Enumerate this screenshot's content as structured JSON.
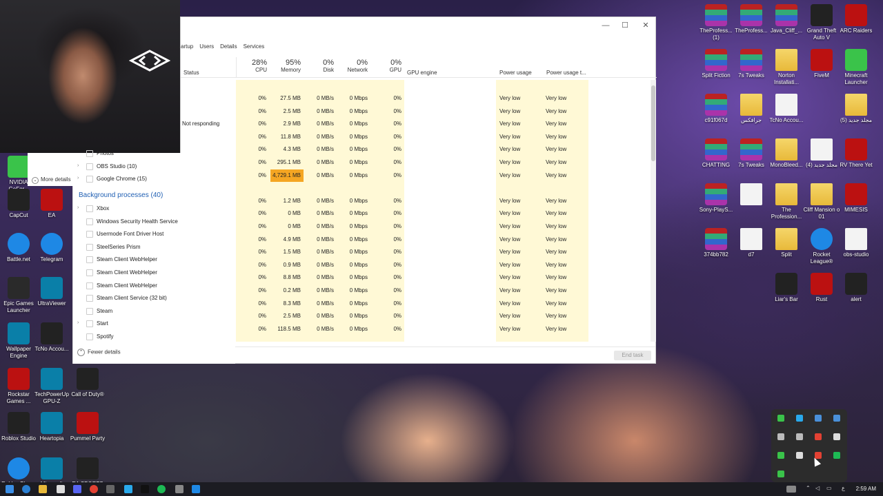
{
  "window": {
    "tabs": [
      "artup",
      "Users",
      "Details",
      "Services"
    ],
    "controls": {
      "minimize": "—",
      "maximize": "☐",
      "close": "✕"
    }
  },
  "columns": {
    "status": "Status",
    "cpu": {
      "pct": "28%",
      "label": "CPU"
    },
    "memory": {
      "pct": "95%",
      "label": "Memory"
    },
    "disk": {
      "pct": "0%",
      "label": "Disk"
    },
    "network": {
      "pct": "0%",
      "label": "Network"
    },
    "gpu": {
      "pct": "0%",
      "label": "GPU"
    },
    "gpu_engine": "GPU engine",
    "power": "Power usage",
    "power_trend": "Power usage t..."
  },
  "rows": [
    {
      "status": "",
      "cpu": "0%",
      "mem": "27.5 MB",
      "disk": "0 MB/s",
      "net": "0 Mbps",
      "gpu": "0%",
      "power": "Very low",
      "trend": "Very low"
    },
    {
      "status": "",
      "cpu": "0%",
      "mem": "2.5 MB",
      "disk": "0 MB/s",
      "net": "0 Mbps",
      "gpu": "0%",
      "power": "Very low",
      "trend": "Very low"
    },
    {
      "status": "Not responding",
      "cpu": "0%",
      "mem": "2.9 MB",
      "disk": "0 MB/s",
      "net": "0 Mbps",
      "gpu": "0%",
      "power": "Very low",
      "trend": "Very low"
    },
    {
      "status": "",
      "cpu": "0%",
      "mem": "11.8 MB",
      "disk": "0 MB/s",
      "net": "0 Mbps",
      "gpu": "0%",
      "power": "Very low",
      "trend": "Very low"
    },
    {
      "status": "",
      "cpu": "0%",
      "mem": "4.3 MB",
      "disk": "0 MB/s",
      "net": "0 Mbps",
      "gpu": "0%",
      "power": "Very low",
      "trend": "Very low"
    },
    {
      "status": "",
      "cpu": "0%",
      "mem": "295.1 MB",
      "disk": "0 MB/s",
      "net": "0 Mbps",
      "gpu": "0%",
      "power": "Very low",
      "trend": "Very low"
    },
    {
      "status": "",
      "cpu": "0%",
      "mem": "4,729.1 MB",
      "disk": "0 MB/s",
      "net": "0 Mbps",
      "gpu": "0%",
      "power": "Very low",
      "trend": "Very low",
      "highlight": true
    },
    {
      "spacer": true
    },
    {
      "status": "",
      "cpu": "0%",
      "mem": "1.2 MB",
      "disk": "0 MB/s",
      "net": "0 Mbps",
      "gpu": "0%",
      "power": "Very low",
      "trend": "Very low"
    },
    {
      "status": "",
      "cpu": "0%",
      "mem": "0 MB",
      "disk": "0 MB/s",
      "net": "0 Mbps",
      "gpu": "0%",
      "power": "Very low",
      "trend": "Very low"
    },
    {
      "status": "",
      "cpu": "0%",
      "mem": "0 MB",
      "disk": "0 MB/s",
      "net": "0 Mbps",
      "gpu": "0%",
      "power": "Very low",
      "trend": "Very low"
    },
    {
      "status": "",
      "cpu": "0%",
      "mem": "4.9 MB",
      "disk": "0 MB/s",
      "net": "0 Mbps",
      "gpu": "0%",
      "power": "Very low",
      "trend": "Very low"
    },
    {
      "status": "",
      "cpu": "0%",
      "mem": "1.5 MB",
      "disk": "0 MB/s",
      "net": "0 Mbps",
      "gpu": "0%",
      "power": "Very low",
      "trend": "Very low"
    },
    {
      "status": "",
      "cpu": "0%",
      "mem": "0.9 MB",
      "disk": "0 MB/s",
      "net": "0 Mbps",
      "gpu": "0%",
      "power": "Very low",
      "trend": "Very low"
    },
    {
      "status": "",
      "cpu": "0%",
      "mem": "8.8 MB",
      "disk": "0 MB/s",
      "net": "0 Mbps",
      "gpu": "0%",
      "power": "Very low",
      "trend": "Very low"
    },
    {
      "status": "",
      "cpu": "0%",
      "mem": "0.2 MB",
      "disk": "0 MB/s",
      "net": "0 Mbps",
      "gpu": "0%",
      "power": "Very low",
      "trend": "Very low"
    },
    {
      "status": "",
      "cpu": "0%",
      "mem": "8.3 MB",
      "disk": "0 MB/s",
      "net": "0 Mbps",
      "gpu": "0%",
      "power": "Very low",
      "trend": "Very low"
    },
    {
      "status": "",
      "cpu": "0%",
      "mem": "2.5 MB",
      "disk": "0 MB/s",
      "net": "0 Mbps",
      "gpu": "0%",
      "power": "Very low",
      "trend": "Very low"
    },
    {
      "status": "",
      "cpu": "0%",
      "mem": "118.5 MB",
      "disk": "0 MB/s",
      "net": "0 Mbps",
      "gpu": "0%",
      "power": "Very low",
      "trend": "Very low"
    }
  ],
  "processes": {
    "apps": [
      {
        "name": "Photos",
        "expand": false
      },
      {
        "name": "OBS Studio (10)",
        "expand": true
      },
      {
        "name": "Google Chrome (15)",
        "expand": true
      }
    ],
    "background_title": "Background processes (40)",
    "background": [
      {
        "name": "Xbox",
        "expand": true
      },
      {
        "name": "Windows Security Health Service",
        "expand": false
      },
      {
        "name": "Usermode Font Driver Host",
        "expand": false
      },
      {
        "name": "SteelSeries Prism",
        "expand": false
      },
      {
        "name": "Steam Client WebHelper",
        "expand": false
      },
      {
        "name": "Steam Client WebHelper",
        "expand": false
      },
      {
        "name": "Steam Client WebHelper",
        "expand": false
      },
      {
        "name": "Steam Client Service (32 bit)",
        "expand": false
      },
      {
        "name": "Steam",
        "expand": false
      },
      {
        "name": "Start",
        "expand": true
      },
      {
        "name": "Spotify",
        "expand": false
      }
    ]
  },
  "footer": {
    "fewer_details": "Fewer details",
    "end_task": "End task"
  },
  "mini": {
    "more_details": "More details"
  },
  "desktop_left": [
    {
      "label": "NVIDIA GeFor...",
      "cls": "green"
    },
    {
      "label": "CapCut",
      "cls": "dark"
    },
    {
      "label": "EA",
      "cls": "red"
    },
    {
      "label": "Battle.net",
      "cls": "blue"
    },
    {
      "label": "Telegram",
      "cls": "blue"
    },
    {
      "label": "Epic Games Launcher",
      "cls": "epic"
    },
    {
      "label": "UltraViewer",
      "cls": "teal"
    },
    {
      "label": "Wallpaper Engine",
      "cls": "teal"
    },
    {
      "label": "TcNo Accou...",
      "cls": "dark"
    },
    {
      "label": "Rockstar Games ...",
      "cls": "red"
    },
    {
      "label": "TechPowerUp GPU-Z",
      "cls": "teal"
    },
    {
      "label": "Call of Duty®",
      "cls": "dark"
    },
    {
      "label": "Roblox Studio",
      "cls": "dark"
    },
    {
      "label": "Heartopia",
      "cls": "teal"
    },
    {
      "label": "Pummel Party",
      "cls": "red"
    },
    {
      "label": "Roblox Player",
      "cls": "blue"
    },
    {
      "label": "Microsoft",
      "cls": "teal"
    },
    {
      "label": "EA SPORTS",
      "cls": "dark"
    }
  ],
  "desktop_right": [
    {
      "label": "TheProfess... (1)",
      "cls": "rar"
    },
    {
      "label": "TheProfess...",
      "cls": "rar"
    },
    {
      "label": "Java_Cliff_...",
      "cls": "rar"
    },
    {
      "label": "Grand Theft Auto V",
      "cls": "dark"
    },
    {
      "label": "ARC Raiders",
      "cls": "red"
    },
    {
      "label": "Split Fiction",
      "cls": "rar"
    },
    {
      "label": "7s Tweaks",
      "cls": "rar"
    },
    {
      "label": "Norton Installati...",
      "cls": "folder"
    },
    {
      "label": "FiveM",
      "cls": "red"
    },
    {
      "label": "Minecraft Launcher",
      "cls": "green"
    },
    {
      "label": "c91f067d",
      "cls": "rar"
    },
    {
      "label": "جرافكس",
      "cls": "folder"
    },
    {
      "label": "TcNo Accou...",
      "cls": "doc"
    },
    {
      "label": "",
      "cls": "none"
    },
    {
      "label": "مجلد جديد (5)",
      "cls": "folder"
    },
    {
      "label": "CHATTING",
      "cls": "rar"
    },
    {
      "label": "7s Tweaks",
      "cls": "rar"
    },
    {
      "label": "MonoBleed...",
      "cls": "folder"
    },
    {
      "label": "مجلد جديد (4)",
      "cls": "doc"
    },
    {
      "label": "RV There Yet",
      "cls": "red"
    },
    {
      "label": "Sony-PlayS...",
      "cls": "rar"
    },
    {
      "label": "",
      "cls": "doc"
    },
    {
      "label": "The Profession...",
      "cls": "folder"
    },
    {
      "label": "Cliff Mansion o 01",
      "cls": "folder"
    },
    {
      "label": "MIMESIS",
      "cls": "red"
    },
    {
      "label": "374bb782",
      "cls": "rar"
    },
    {
      "label": "d7",
      "cls": "doc"
    },
    {
      "label": "Split",
      "cls": "folder"
    },
    {
      "label": "Rocket League®",
      "cls": "blue"
    },
    {
      "label": "obs-studio",
      "cls": "doc"
    },
    {
      "label": "",
      "cls": "none"
    },
    {
      "label": "",
      "cls": "none"
    },
    {
      "label": "Liar's Bar",
      "cls": "dark"
    },
    {
      "label": "Rust",
      "cls": "red"
    },
    {
      "label": "alert",
      "cls": "dark"
    }
  ],
  "taskbar": {
    "clock": "2:59 AM",
    "lang": "ع"
  },
  "colors": {
    "yellow": "#fff9d6",
    "memory_hot": "#f5a623",
    "link": "#1f5fb3"
  }
}
